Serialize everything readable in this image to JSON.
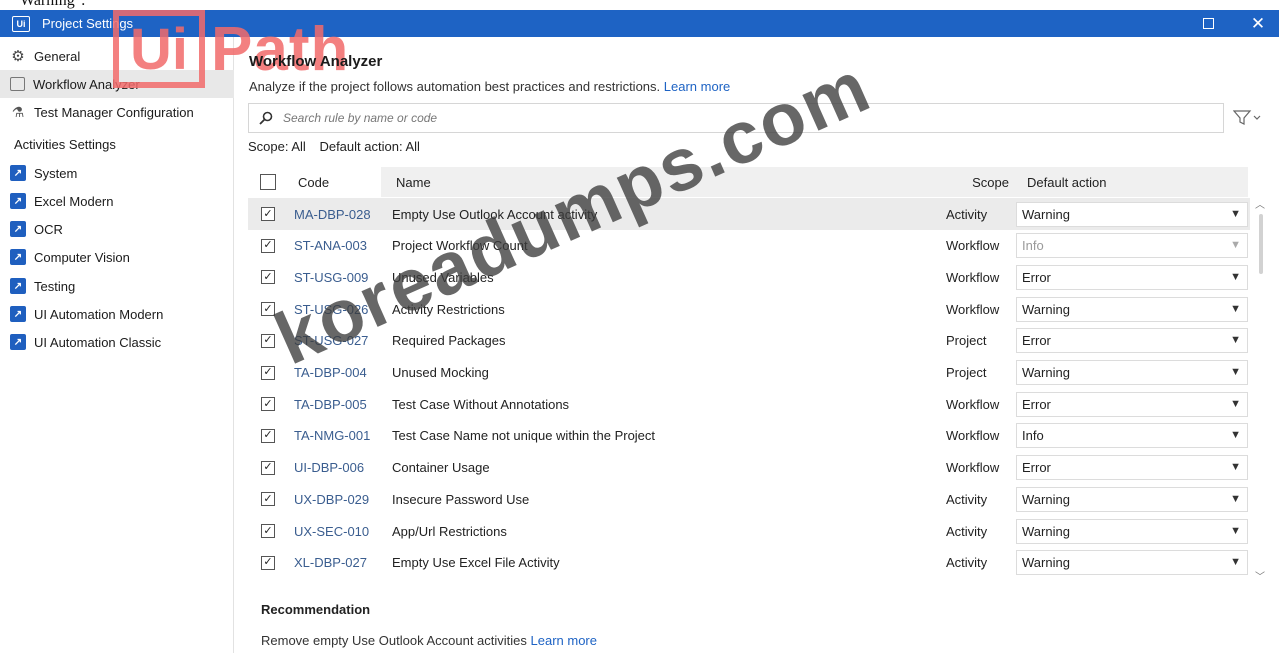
{
  "top_fragment": "Warning\".",
  "window": {
    "title": "Project Settings",
    "app_icon": "uipath-studio-icon",
    "maximize_icon": "maximize-icon",
    "close_icon": "close-icon",
    "close_glyph": "✕",
    "accent_color": "#1e63c4"
  },
  "logo": {
    "ui": "Ui",
    "path": "Path"
  },
  "sidebar": {
    "items": [
      {
        "label": "General",
        "icon": "gear-icon"
      },
      {
        "label": "Workflow Analyzer",
        "icon": "workflow-analyzer-icon"
      },
      {
        "label": "Test Manager Configuration",
        "icon": "test-manager-icon"
      }
    ],
    "activities_header": "Activities Settings",
    "activities": [
      {
        "label": "System",
        "icon": "package-icon"
      },
      {
        "label": "Excel Modern",
        "icon": "package-icon"
      },
      {
        "label": "OCR",
        "icon": "package-icon"
      },
      {
        "label": "Computer Vision",
        "icon": "package-icon"
      },
      {
        "label": "Testing",
        "icon": "package-icon"
      },
      {
        "label": "UI Automation Modern",
        "icon": "package-icon"
      },
      {
        "label": "UI Automation Classic",
        "icon": "package-icon"
      }
    ]
  },
  "main": {
    "title": "Workflow Analyzer",
    "subtitle": "Analyze if the project follows automation best practices and restrictions.",
    "learn_more": "Learn more",
    "search_placeholder": "Search rule by name or code",
    "scope_label": "Scope: All",
    "default_action_label": "Default action: All",
    "columns": {
      "code": "Code",
      "name": "Name",
      "scope": "Scope",
      "action": "Default action"
    },
    "rows": [
      {
        "code": "MA-DBP-028",
        "name": "Empty Use Outlook Account activity",
        "scope": "Activity",
        "action": "Warning",
        "checked": true,
        "selected": true,
        "disabled": false
      },
      {
        "code": "ST-ANA-003",
        "name": "Project Workflow Count",
        "scope": "Workflow",
        "action": "Info",
        "checked": true,
        "selected": false,
        "disabled": true
      },
      {
        "code": "ST-USG-009",
        "name": "Unused Variables",
        "scope": "Workflow",
        "action": "Error",
        "checked": true,
        "selected": false,
        "disabled": false
      },
      {
        "code": "ST-USG-026",
        "name": "Activity Restrictions",
        "scope": "Workflow",
        "action": "Warning",
        "checked": true,
        "selected": false,
        "disabled": false
      },
      {
        "code": "ST-USG-027",
        "name": "Required Packages",
        "scope": "Project",
        "action": "Error",
        "checked": true,
        "selected": false,
        "disabled": false
      },
      {
        "code": "TA-DBP-004",
        "name": "Unused Mocking",
        "scope": "Project",
        "action": "Warning",
        "checked": true,
        "selected": false,
        "disabled": false
      },
      {
        "code": "TA-DBP-005",
        "name": "Test Case Without Annotations",
        "scope": "Workflow",
        "action": "Error",
        "checked": true,
        "selected": false,
        "disabled": false
      },
      {
        "code": "TA-NMG-001",
        "name": "Test Case Name not unique within the Project",
        "scope": "Workflow",
        "action": "Info",
        "checked": true,
        "selected": false,
        "disabled": false
      },
      {
        "code": "UI-DBP-006",
        "name": "Container Usage",
        "scope": "Workflow",
        "action": "Error",
        "checked": true,
        "selected": false,
        "disabled": false
      },
      {
        "code": "UX-DBP-029",
        "name": "Insecure Password Use",
        "scope": "Activity",
        "action": "Warning",
        "checked": true,
        "selected": false,
        "disabled": false
      },
      {
        "code": "UX-SEC-010",
        "name": "App/Url Restrictions",
        "scope": "Activity",
        "action": "Warning",
        "checked": true,
        "selected": false,
        "disabled": false
      },
      {
        "code": "XL-DBP-027",
        "name": "Empty Use Excel File Activity",
        "scope": "Activity",
        "action": "Warning",
        "checked": true,
        "selected": false,
        "disabled": false
      }
    ],
    "recommendation_title": "Recommendation",
    "recommendation_text": "Remove empty Use Outlook Account activities",
    "recommendation_link": "Learn more"
  },
  "watermark": "koreadumps.com"
}
